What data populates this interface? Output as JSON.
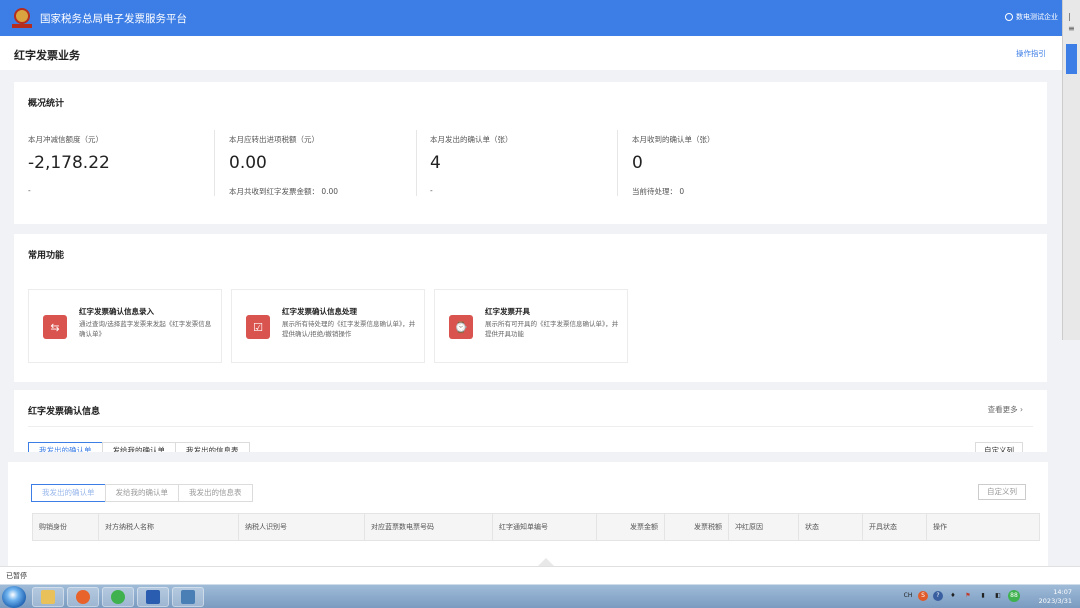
{
  "header": {
    "platform_title": "国家税务总局电子发票服务平台",
    "user_label": "数电测试企业",
    "scroll_mark_1": "|",
    "scroll_mark_2": "≡"
  },
  "page": {
    "title": "红字发票业务",
    "guide_link": "操作指引"
  },
  "stats": {
    "title": "概况统计",
    "items": [
      {
        "label": "本月冲减信额度（元）",
        "value": "-2,178.22",
        "note": "-"
      },
      {
        "label": "本月应转出进项税额（元）",
        "value": "0.00",
        "note": "本月共收到红字发票金额： 0.00"
      },
      {
        "label": "本月发出的确认单（张）",
        "value": "4",
        "note": "-"
      },
      {
        "label": "本月收到的确认单（张）",
        "value": "0",
        "note": "当前待处理： 0"
      }
    ]
  },
  "functions": {
    "title": "常用功能",
    "items": [
      {
        "title": "红字发票确认信息录入",
        "desc": "通过查询/选择蓝字发票来发起《红字发票信息确认单》",
        "icon": "swap-arrows-icon",
        "glyph": "⇆"
      },
      {
        "title": "红字发票确认信息处理",
        "desc": "展示所有待处理的《红字发票信息确认单》，并提供确认/拒绝/撤销操作",
        "icon": "document-check-icon",
        "glyph": "☑"
      },
      {
        "title": "红字发票开具",
        "desc": "展示所有可开具的《红字发票信息确认单》，并提供开具功能",
        "icon": "document-clock-icon",
        "glyph": "⌚"
      }
    ]
  },
  "confirm": {
    "title": "红字发票确认信息",
    "view_more": "查看更多 ›",
    "tabs": [
      "我发出的确认单",
      "发给我的确认单",
      "我发出的信息表"
    ],
    "custom_columns": "自定义列",
    "table_headers": [
      "购销身份",
      "对方纳税人名称",
      "纳税人识别号",
      "对应蓝票数电票号码",
      "红字通知单编号",
      "发票金额",
      "发票税额",
      "冲红原因",
      "状态",
      "开具状态",
      "操作"
    ]
  },
  "status_bar": {
    "text": "已暂停"
  },
  "taskbar": {
    "apps": [
      {
        "name": "file-explorer-icon",
        "color": "#e8c15a"
      },
      {
        "name": "firefox-icon",
        "color": "#e8632b"
      },
      {
        "name": "wechat-icon",
        "color": "#3fb24f"
      },
      {
        "name": "word-icon",
        "color": "#2a5db0"
      },
      {
        "name": "image-viewer-icon",
        "color": "#4a7fb5"
      }
    ],
    "tray_labels": [
      "CH",
      "S",
      "?",
      "♦",
      "⚑",
      "▮",
      "◧",
      "88"
    ],
    "time": "14:07",
    "date": "2023/3/31"
  }
}
